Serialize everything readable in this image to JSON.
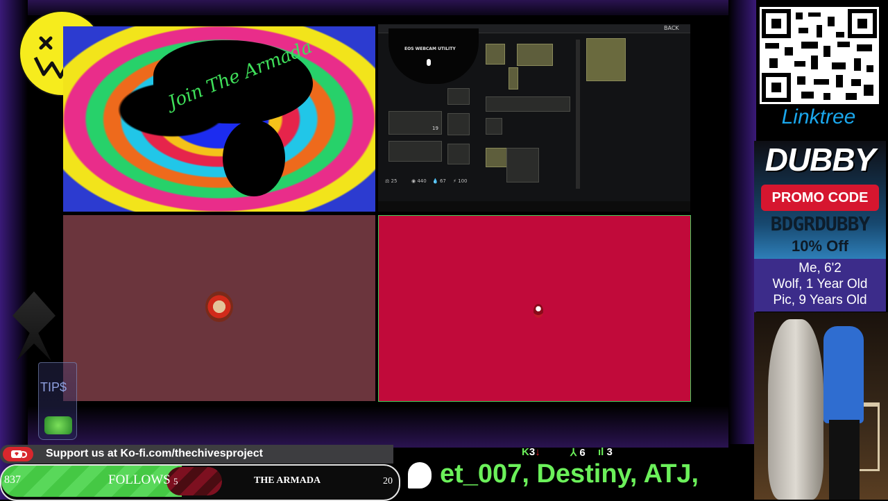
{
  "banner": {
    "text": "Join The Armada"
  },
  "game": {
    "back_label": "BACK",
    "webcam_title": "EOS WEBCAM UTILITY",
    "weapon_count": "19",
    "stats": {
      "weight": "25",
      "money": "440",
      "water": "67",
      "health": "100"
    }
  },
  "tips": {
    "label": "TIP$"
  },
  "sidebar": {
    "linktree": "Linktree",
    "dubby_title": "DUBBY",
    "promo_label": "PROMO CODE",
    "promo_code": "BDGRDUBBY",
    "promo_off": "10% Off",
    "pet_lines": [
      "Me, 6'2",
      "Wolf, 1 Year Old",
      "Pic, 9 Years Old"
    ]
  },
  "support": {
    "text": "Support us at Ko-fi.com/thechivesproject"
  },
  "follows": {
    "count": "837",
    "label": "FOLLOWS",
    "goal_current": "5",
    "goal_name": "THE ARMADA",
    "goal_target": "20"
  },
  "stream_stats": {
    "kills": "3",
    "downs": "6",
    "bars": "3"
  },
  "ticker": {
    "text": "et_007, Destiny, ATJ,"
  },
  "colors": {
    "ticker_green": "#6bf05a",
    "follow_green": "#45c844",
    "promo_red": "#d6162f",
    "cam_right": "#c10a3a",
    "cam_left": "#6b353d"
  }
}
